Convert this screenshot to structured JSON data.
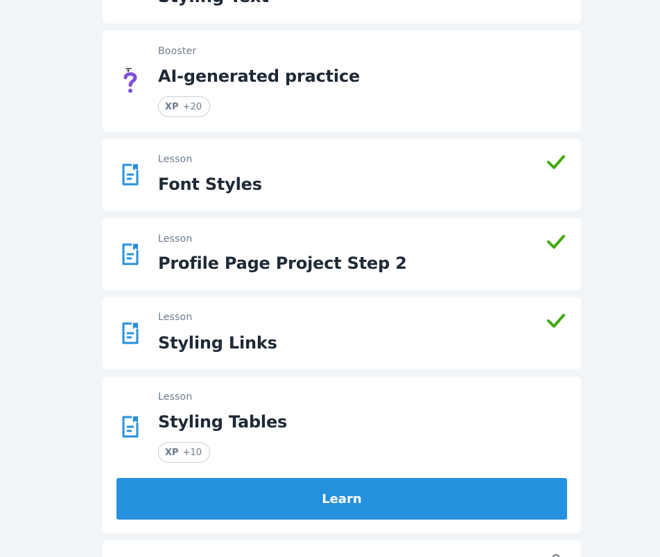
{
  "items": [
    {
      "kind": "",
      "title": "Styling Text"
    },
    {
      "kind": "Booster",
      "title": "AI-generated practice",
      "xp_label": "XP",
      "xp_value": "+20"
    },
    {
      "kind": "Lesson",
      "title": "Font Styles"
    },
    {
      "kind": "Lesson",
      "title": "Profile Page Project Step 2"
    },
    {
      "kind": "Lesson",
      "title": "Styling Links"
    },
    {
      "kind": "Lesson",
      "title": "Styling Tables",
      "xp_label": "XP",
      "xp_value": "+10",
      "button_label": "Learn"
    }
  ],
  "colors": {
    "background": "#f2f5f7",
    "card": "#ffffff",
    "accent_blue": "#2590de",
    "check_green": "#43a80f",
    "booster_purple": "#7f4fd6"
  }
}
